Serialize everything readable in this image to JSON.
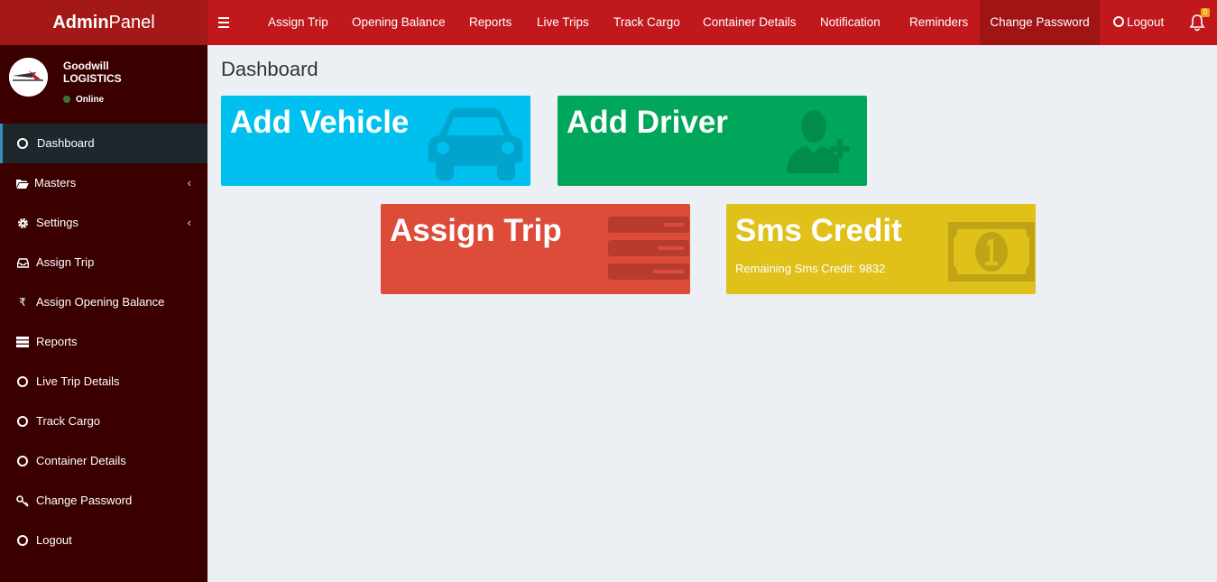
{
  "brand": {
    "bold": "Admin",
    "light": "Panel"
  },
  "topnav": {
    "items": [
      "Assign Trip",
      "Opening Balance",
      "Reports",
      "Live Trips",
      "Track Cargo",
      "Container Details",
      "Notification",
      "Reminders",
      "Change Password"
    ],
    "logout": "Logout",
    "notification_count": "0"
  },
  "user": {
    "name_line1": "Goodwill",
    "name_line2": "LOGISTICS",
    "status": "Online"
  },
  "sidebar": {
    "items": [
      {
        "label": "Dashboard",
        "icon": "circle-icon"
      },
      {
        "label": "Masters",
        "icon": "folder-open-icon"
      },
      {
        "label": "Settings",
        "icon": "gear-icon"
      },
      {
        "label": "Assign Trip",
        "icon": "inbox-icon"
      },
      {
        "label": "Assign Opening Balance",
        "icon": "rupee-icon"
      },
      {
        "label": "Reports",
        "icon": "server-icon"
      },
      {
        "label": "Live Trip Details",
        "icon": "circle-icon"
      },
      {
        "label": "Track Cargo",
        "icon": "circle-icon"
      },
      {
        "label": "Container Details",
        "icon": "circle-icon"
      },
      {
        "label": "Change Password",
        "icon": "key-icon"
      },
      {
        "label": "Logout",
        "icon": "circle-icon"
      }
    ]
  },
  "content": {
    "title": "Dashboard",
    "tiles": {
      "add_vehicle": {
        "title": "Add Vehicle",
        "color": "#00c0ef",
        "icon": "car-icon"
      },
      "add_driver": {
        "title": "Add Driver",
        "color": "#00a65a",
        "icon": "user-plus-icon"
      },
      "assign_trip": {
        "title": "Assign Trip",
        "color": "#dd4b39",
        "icon": "list-icon"
      },
      "sms_credit": {
        "title": "Sms Credit",
        "subtitle": "Remaining Sms Credit: 9832",
        "color": "#e0c11a",
        "icon": "money-icon"
      }
    }
  }
}
